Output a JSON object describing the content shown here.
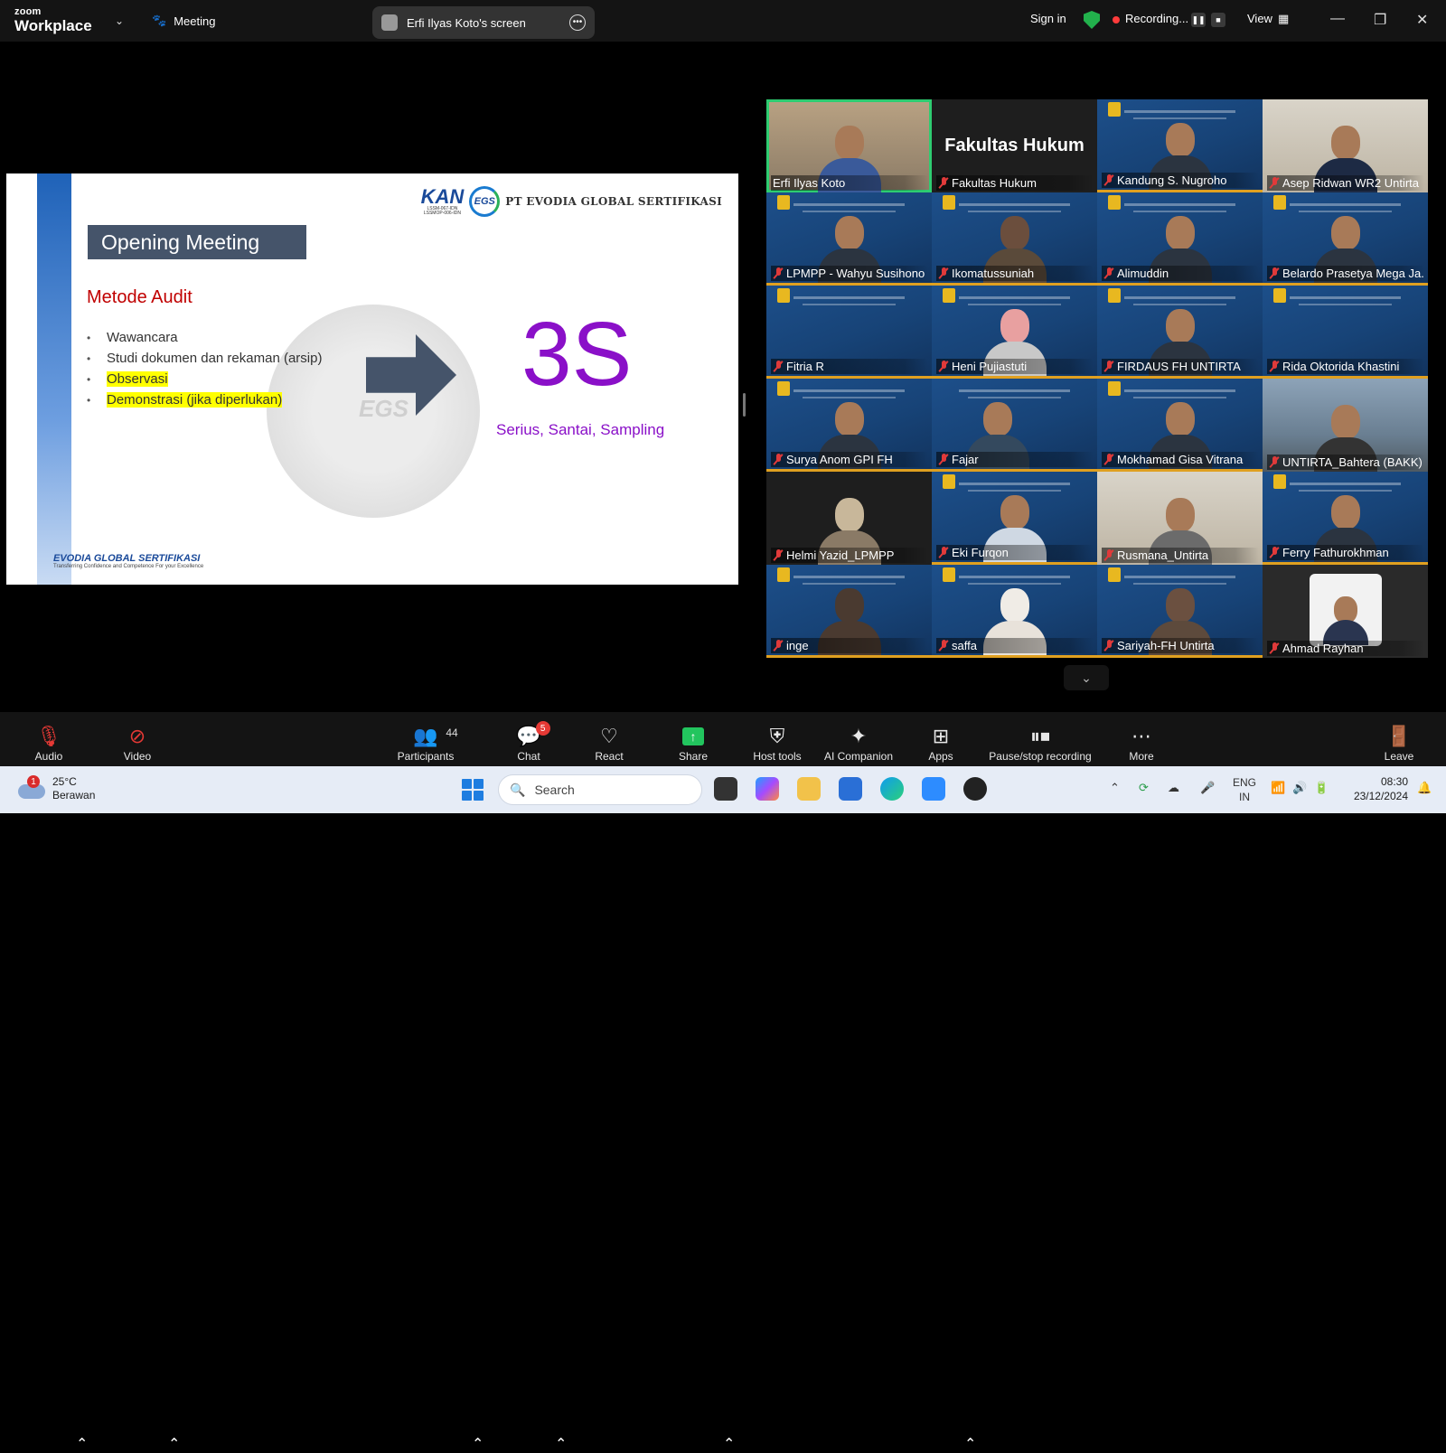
{
  "titlebar": {
    "logo_top": "zoom",
    "logo_bottom": "Workplace",
    "meeting": "Meeting",
    "screen_share": "Erfi Ilyas Koto's screen",
    "sign_in": "Sign in",
    "recording": "Recording...",
    "view": "View"
  },
  "slide": {
    "kan": "KAN",
    "kan_sub1": "LSSM-067-IDN",
    "kan_sub2": "LSSMOP-006-IDN",
    "egs": "EGS",
    "company": "PT EVODIA GLOBAL SERTIFIKASI",
    "title": "Opening Meeting",
    "subtitle": "Metode Audit",
    "bullets": [
      "Wawancara",
      "Studi dokumen dan rekaman (arsip)",
      "Observasi",
      "Demonstrasi (jika diperlukan)"
    ],
    "watermark": "EGS",
    "big": "3S",
    "big_sub": "Serius, Santai, Sampling",
    "footer_brand": "EVODIA GLOBAL SERTIFIKASI",
    "footer_tagline": "Transferring Confidence and Competence For your Excellence"
  },
  "gallery": {
    "big_label": "Fakultas Hukum",
    "participants": [
      "Erfi Ilyas Koto",
      "Fakultas Hukum",
      "Kandung S. Nugroho",
      "Asep Ridwan WR2 Untirta",
      "LPMPP - Wahyu Susihono",
      "Ikomatussuniah",
      "Alimuddin",
      "Belardo Prasetya Mega Ja...",
      "Fitria R",
      "Heni Pujiastuti",
      "FIRDAUS FH UNTIRTA",
      "Rida Oktorida Khastini",
      "Surya Anom GPI FH",
      "Fajar",
      "Mokhamad Gisa Vitrana",
      "UNTIRTA_Bahtera (BAKK)",
      "Helmi Yazid_LPMPP",
      "Eki Furqon",
      "Rusmana_Untirta",
      "Ferry Fathurokhman",
      "inge",
      "saffa",
      "Sariyah-FH Untirta",
      "Ahmad Rayhan"
    ]
  },
  "toolbar": {
    "audio": "Audio",
    "video": "Video",
    "participants": "Participants",
    "participants_count": "44",
    "chat": "Chat",
    "chat_badge": "5",
    "react": "React",
    "share": "Share",
    "host_tools": "Host tools",
    "ai_companion": "AI Companion",
    "apps": "Apps",
    "pause_recording": "Pause/stop recording",
    "more": "More",
    "leave": "Leave"
  },
  "taskbar": {
    "weather_badge": "1",
    "temp": "25°C",
    "condition": "Berawan",
    "search": "Search",
    "lang1": "ENG",
    "lang2": "IN",
    "time": "08:30",
    "date": "23/12/2024"
  }
}
